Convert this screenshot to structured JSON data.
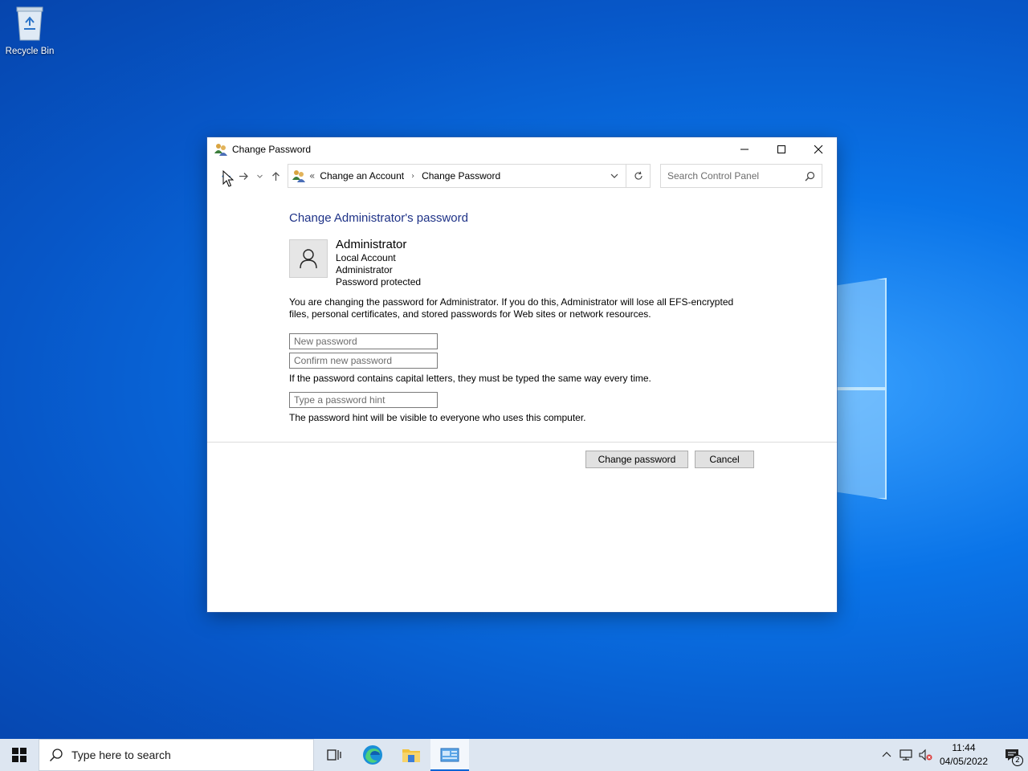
{
  "desktop": {
    "icons": [
      {
        "label": "Recycle Bin",
        "icon": "recycle-bin-icon"
      }
    ]
  },
  "window": {
    "title": "Change Password",
    "address": {
      "overflow": "«",
      "crumbs": [
        "Change an Account",
        "Change Password"
      ]
    },
    "search_placeholder": "Search Control Panel",
    "heading": "Change Administrator's password",
    "user": {
      "name": "Administrator",
      "lines": [
        "Local Account",
        "Administrator",
        "Password protected"
      ]
    },
    "warning": "You are changing the password for Administrator.  If you do this, Administrator will lose all EFS-encrypted files, personal certificates, and stored passwords for Web sites or network resources.",
    "fields": {
      "new_password_placeholder": "New password",
      "confirm_password_placeholder": "Confirm new password",
      "hint_placeholder": "Type a password hint"
    },
    "capital_note": "If the password contains capital letters, they must be typed the same way every time.",
    "hint_note": "The password hint will be visible to everyone who uses this computer.",
    "buttons": {
      "change": "Change password",
      "cancel": "Cancel"
    }
  },
  "taskbar": {
    "search_placeholder": "Type here to search",
    "apps": [
      "task-view-icon",
      "edge-icon",
      "file-explorer-icon",
      "control-panel-icon"
    ],
    "clock": {
      "time": "11:44",
      "date": "04/05/2022"
    },
    "notification_count": "2",
    "accent": "#0a64d6"
  }
}
